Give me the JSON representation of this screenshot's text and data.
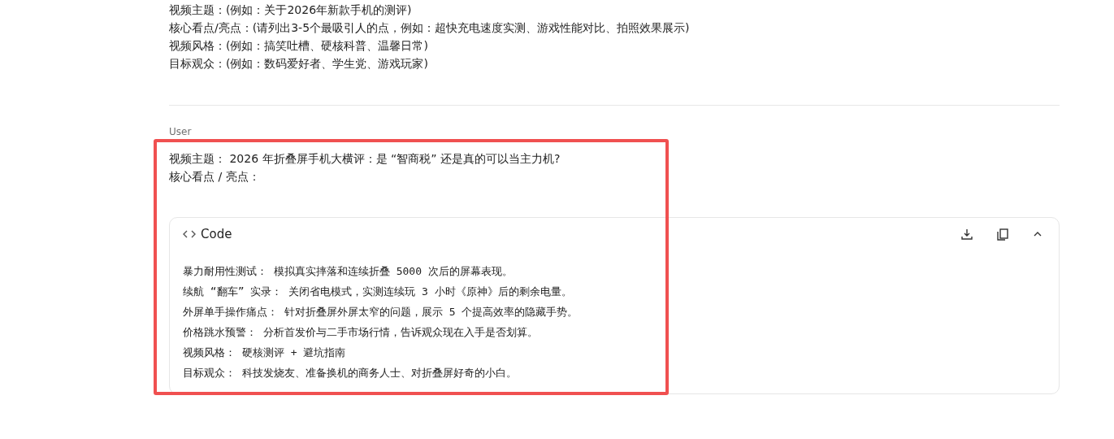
{
  "previous_message": {
    "lines": [
      "视频主题：(例如：关于2026年新款手机的测评)",
      "核心看点/亮点：(请列出3-5个最吸引人的点，例如：超快充电速度实测、游戏性能对比、拍照效果展示)",
      "视频风格：(例如：搞笑吐槽、硬核科普、温馨日常)",
      "目标观众：(例如：数码爱好者、学生党、游戏玩家)"
    ]
  },
  "user_message": {
    "role": "User",
    "highlighted": true,
    "lines": [
      "视频主题： 2026 年折叠屏手机大横评：是 “智商税” 还是真的可以当主力机?",
      "核心看点 / 亮点："
    ],
    "code_block": {
      "title": "Code",
      "expanded": true,
      "lines": [
        "暴力耐用性测试： 模拟真实摔落和连续折叠 5000 次后的屏幕表现。",
        "续航 “翻车” 实录： 关闭省电模式，实测连续玩 3 小时《原神》后的剩余电量。",
        "外屏单手操作痛点： 针对折叠屏外屏太窄的问题，展示 5 个提高效率的隐藏手势。",
        "价格跳水预警： 分析首发价与二手市场行情，告诉观众现在入手是否划算。",
        "视频风格： 硬核测评 + 避坑指南",
        "目标观众： 科技发烧友、准备换机的商务人士、对折叠屏好奇的小白。"
      ]
    }
  }
}
